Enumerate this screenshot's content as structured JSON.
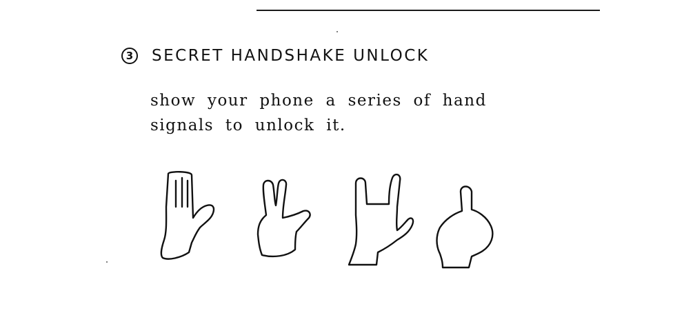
{
  "heading": {
    "number": "3",
    "title": "SECRET HANDSHAKE UNLOCK"
  },
  "body": {
    "lines": [
      "show your phone a series of hand",
      "signals to unlock it."
    ]
  },
  "illustrations": [
    {
      "icon": "open-palm-hand-icon"
    },
    {
      "icon": "peace-sign-hand-icon"
    },
    {
      "icon": "rock-horns-hand-icon"
    },
    {
      "icon": "index-finger-up-hand-icon"
    }
  ]
}
